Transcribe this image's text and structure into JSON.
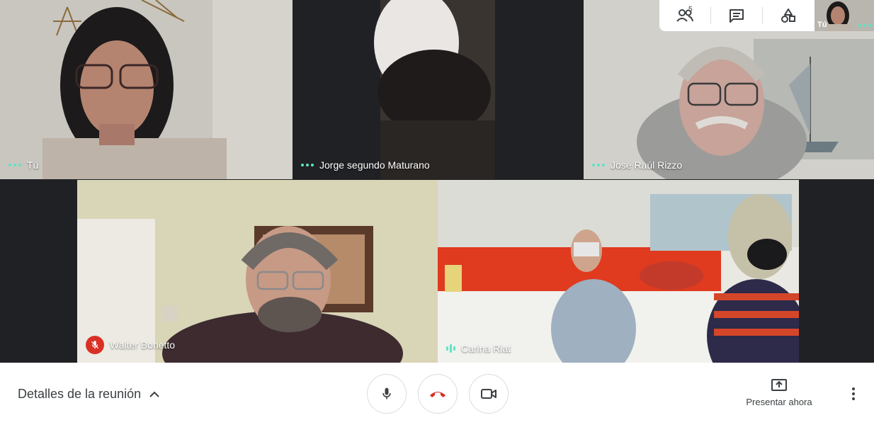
{
  "participants": [
    {
      "name": "Tú",
      "audio": "speaking-dots"
    },
    {
      "name": "Jorge segundo Maturano",
      "audio": "speaking-dots"
    },
    {
      "name": "José Raúl Rizzo",
      "audio": "speaking-dots"
    },
    {
      "name": "Walter Bonetto",
      "audio": "muted"
    },
    {
      "name": "Carina Riat",
      "audio": "active"
    }
  ],
  "top_panel": {
    "people_icon": "people-icon",
    "people_count": "5",
    "chat_icon": "chat-icon",
    "activities_icon": "activities-icon",
    "self_label": "Tú"
  },
  "bottom_bar": {
    "meeting_details_label": "Detalles de la reunión",
    "present_label": "Presentar ahora",
    "mic_icon": "microphone-icon",
    "hangup_icon": "hang-up-icon",
    "camera_icon": "camera-icon",
    "more_icon": "more-vert-icon"
  },
  "colors": {
    "hangup": "#d93025",
    "muted": "#d93025",
    "speaking": "#5fe3c3"
  }
}
